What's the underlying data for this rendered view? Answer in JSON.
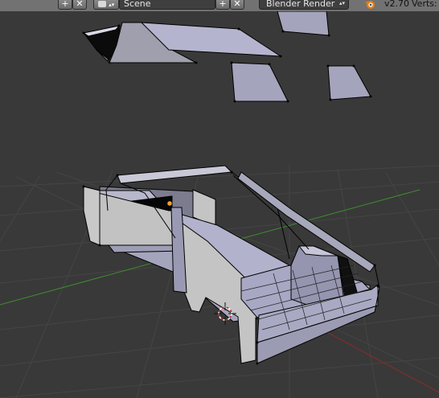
{
  "header": {
    "scene_label": "Scene",
    "render_engine": "Blender Render",
    "version": "v2.70",
    "stats_label": "Verts:"
  },
  "icons": {
    "add": "plus-icon",
    "close": "x-icon",
    "scene": "scene-icon",
    "dropdown": "up-down-arrows-icon",
    "blender": "blender-logo-icon"
  },
  "colors": {
    "header_bg": "#727272",
    "viewport_bg": "#393939",
    "x_axis": "#8e2a2a",
    "y_axis": "#3e8e2e",
    "mesh_face": "#a9a9c6",
    "mesh_edge": "#000000",
    "cursor": "#c33030"
  }
}
